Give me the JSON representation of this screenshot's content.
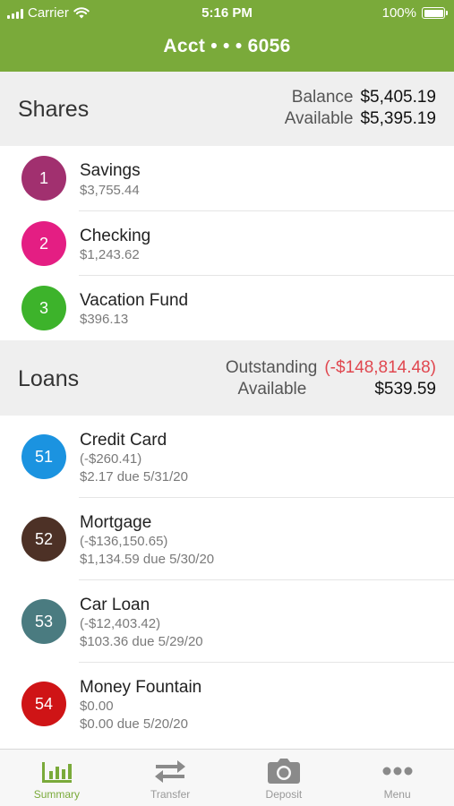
{
  "status_bar": {
    "carrier": "Carrier",
    "time": "5:16 PM",
    "battery": "100%"
  },
  "header": {
    "title": "Acct • • • 6056"
  },
  "shares": {
    "title": "Shares",
    "balance_label": "Balance",
    "balance_value": "$5,405.19",
    "available_label": "Available",
    "available_value": "$5,395.19",
    "items": [
      {
        "number": "1",
        "name": "Savings",
        "amount": "$3,755.44",
        "color": "#a1306f"
      },
      {
        "number": "2",
        "name": "Checking",
        "amount": "$1,243.62",
        "color": "#e41e83"
      },
      {
        "number": "3",
        "name": "Vacation Fund",
        "amount": "$396.13",
        "color": "#3db32b"
      }
    ]
  },
  "loans": {
    "title": "Loans",
    "outstanding_label": "Outstanding",
    "outstanding_value": "(-$148,814.48)",
    "available_label": "Available",
    "available_value": "$539.59",
    "items": [
      {
        "number": "51",
        "name": "Credit Card",
        "balance": "(-$260.41)",
        "due": "$2.17 due 5/31/20",
        "color": "#1b93e0"
      },
      {
        "number": "52",
        "name": "Mortgage",
        "balance": "(-$136,150.65)",
        "due": "$1,134.59 due 5/30/20",
        "color": "#4d3126"
      },
      {
        "number": "53",
        "name": "Car Loan",
        "balance": "(-$12,403.42)",
        "due": "$103.36 due 5/29/20",
        "color": "#4a7b80"
      },
      {
        "number": "54",
        "name": "Money Fountain",
        "balance": "$0.00",
        "due": "$0.00 due 5/20/20",
        "color": "#cf1416"
      }
    ]
  },
  "tabs": [
    {
      "label": "Summary",
      "icon": "bar-chart-icon",
      "active": true
    },
    {
      "label": "Transfer",
      "icon": "transfer-arrows-icon",
      "active": false
    },
    {
      "label": "Deposit",
      "icon": "camera-icon",
      "active": false
    },
    {
      "label": "Menu",
      "icon": "more-dots-icon",
      "active": false
    }
  ],
  "colors": {
    "brand": "#7aaa3a",
    "negative": "#e0474f"
  }
}
